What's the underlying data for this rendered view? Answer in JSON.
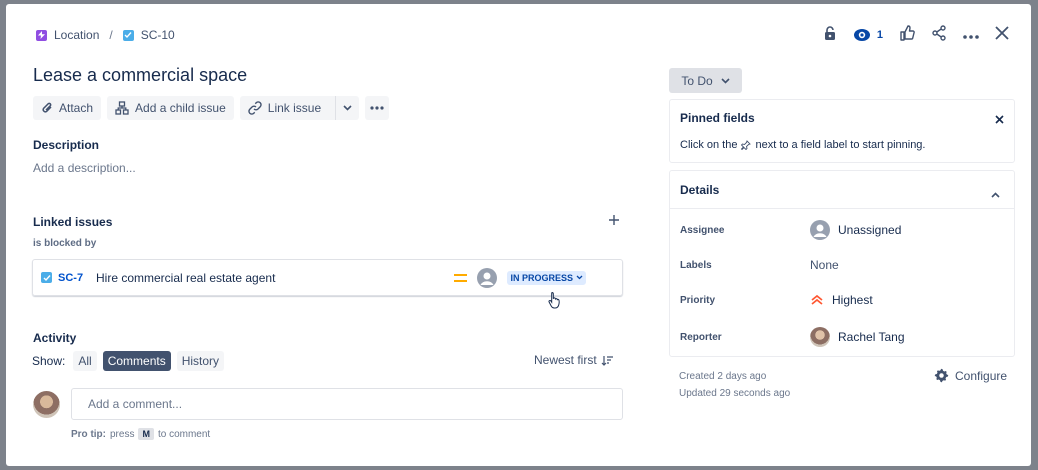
{
  "breadcrumb": {
    "parent_label": "Location",
    "separator": "/",
    "issue_key": "SC-10"
  },
  "issue": {
    "title": "Lease a commercial space"
  },
  "actions": {
    "attach": "Attach",
    "add_child": "Add a child issue",
    "link_issue": "Link issue"
  },
  "description": {
    "heading": "Description",
    "placeholder": "Add a description..."
  },
  "linked_issues": {
    "heading": "Linked issues",
    "relation": "is blocked by",
    "items": [
      {
        "key": "SC-7",
        "summary": "Hire commercial real estate agent",
        "status": "IN PROGRESS"
      }
    ]
  },
  "activity": {
    "heading": "Activity",
    "show_label": "Show:",
    "tabs": [
      "All",
      "Comments",
      "History"
    ],
    "active_tab": "Comments",
    "sort_label": "Newest first",
    "comment_placeholder": "Add a comment...",
    "protip_prefix": "Pro tip:",
    "protip_press": "press",
    "protip_key": "M",
    "protip_suffix": "to comment"
  },
  "toolbar": {
    "watch_count": "1"
  },
  "status": {
    "label": "To Do"
  },
  "pinned_fields": {
    "heading": "Pinned fields",
    "hint_before": "Click on the",
    "hint_after": "next to a field label to start pinning."
  },
  "details": {
    "heading": "Details",
    "fields": [
      {
        "label": "Assignee",
        "value": "Unassigned"
      },
      {
        "label": "Labels",
        "value": "None"
      },
      {
        "label": "Priority",
        "value": "Highest"
      },
      {
        "label": "Reporter",
        "value": "Rachel Tang"
      }
    ]
  },
  "footer": {
    "created": "Created 2 days ago",
    "updated": "Updated 29 seconds ago",
    "configure": "Configure"
  },
  "colors": {
    "epic": "#904ee2",
    "task": "#4bade8",
    "link": "#0052cc",
    "priority_highest": "#ff5630",
    "priority_medium": "#ffab00"
  }
}
